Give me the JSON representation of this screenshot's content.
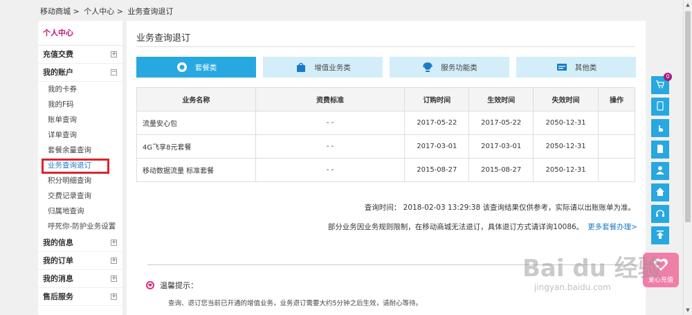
{
  "breadcrumb": [
    "移动商城 >",
    "个人中心 >",
    "业务查询退订"
  ],
  "sidebar": {
    "header": "个人中心",
    "groups": [
      {
        "label": "充值交费",
        "toggle": "+"
      },
      {
        "label": "我的账户",
        "toggle": "−"
      },
      {
        "label": "我的信息",
        "toggle": "+"
      },
      {
        "label": "我的订单",
        "toggle": "+"
      },
      {
        "label": "我的消息",
        "toggle": "+"
      },
      {
        "label": "售后服务",
        "toggle": "+"
      }
    ],
    "account_items": [
      "我的卡券",
      "我的F码",
      "账单查询",
      "详单查询",
      "套餐余量查询",
      "业务查询退订",
      "积分明细查询",
      "交费记录查询",
      "归属地查询",
      "呼死你-防护业务设置"
    ]
  },
  "main": {
    "title": "业务查询退订",
    "tabs": [
      {
        "label": "套餐类",
        "icon": "package-icon"
      },
      {
        "label": "增值业务类",
        "icon": "bag-icon"
      },
      {
        "label": "服务功能类",
        "icon": "service-icon"
      },
      {
        "label": "其他类",
        "icon": "card-icon"
      }
    ],
    "table": {
      "headers": [
        "业务名称",
        "资费标准",
        "订购时间",
        "生效时间",
        "失效时间",
        "操作"
      ],
      "rows": [
        [
          "流量安心包",
          "- -",
          "2017-05-22",
          "2017-05-22",
          "2050-12-31",
          ""
        ],
        [
          "4G飞享8元套餐",
          "- -",
          "2017-03-01",
          "2017-03-01",
          "2050-12-31",
          ""
        ],
        [
          "移动数据流量 标准套餐",
          "- -",
          "2015-08-27",
          "2015-08-27",
          "2050-12-31",
          ""
        ]
      ]
    },
    "query_time": "查询时间： 2018-02-03 13:29:38 该查询结果仅供参考，实际请以出账账单为准。",
    "notice": "部分业务因业务规则限制，在移动商城无法退订，具体退订方式请详询10086。",
    "more_link": "更多套餐办理>",
    "tip_title": "温馨提示：",
    "tip_text": "查询、退订您当前已开通的增值业务，业务退订需要大约5分钟之后生效，请耐心等待。"
  },
  "floatbar": {
    "cart_count": "0",
    "charge_label": "爱心充值"
  },
  "watermark": {
    "text": "Bai du 经验",
    "url": "jingyan.baidu.com"
  },
  "colors": {
    "accent": "#28a8e0",
    "tab_inactive": "#d3eef9",
    "brand": "#c0127a",
    "highlight": "#d9262c"
  }
}
